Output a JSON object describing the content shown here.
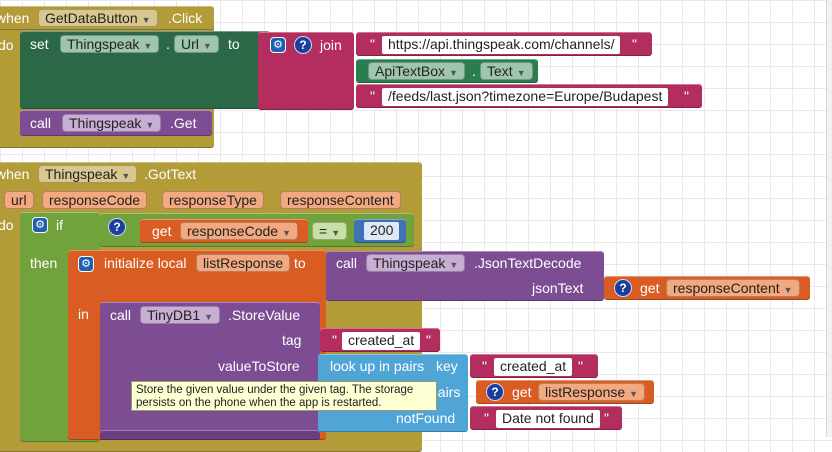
{
  "event1": {
    "when": "when",
    "component": "GetDataButton",
    "event": ".Click",
    "do": "do",
    "set": "set",
    "setComponent": "Thingspeak",
    "setProperty": "Url",
    "to": "to",
    "join": "join",
    "quote": "\"",
    "str1": "https://api.thingspeak.com/channels/",
    "textbox": "ApiTextBox",
    "textProp": "Text",
    "str2": "/feeds/last.json?timezone=Europe/Budapest",
    "call": "call",
    "callComponent": "Thingspeak",
    "callMethod": ".Get"
  },
  "event2": {
    "when": "when",
    "component": "Thingspeak",
    "event": ".GotText",
    "params": [
      "url",
      "responseCode",
      "responseType",
      "responseContent"
    ],
    "do": "do",
    "if": "if",
    "get": "get",
    "getVar": "responseCode",
    "op": "=",
    "num": "200",
    "then": "then",
    "initLocal": "initialize local",
    "localName": "listResponse",
    "to": "to",
    "call": "call",
    "decodeComponent": "Thingspeak",
    "decodeMethod": ".JsonTextDecode",
    "jsonText": "jsonText",
    "getContent": "responseContent",
    "in": "in",
    "storeComponent": "TinyDB1",
    "storeMethod": ".StoreValue",
    "tag": "tag",
    "tagStr": "created_at",
    "valueToStore": "valueToStore",
    "lookup": "look up in pairs",
    "key": "key",
    "keyStr": "created_at",
    "pairs": "pairs",
    "pairsVar": "listResponse",
    "notFound": "notFound",
    "notFoundStr": "Date not found"
  },
  "tooltip": {
    "line1": "Store the given value under the given tag. The storage",
    "line2": "persists on the phone when the app is restarted."
  },
  "colors": {
    "event": "#b39b38",
    "setter": "#2a6848",
    "text": "#b32d5e",
    "control": "#71a23c",
    "variable": "#d95d23",
    "procedure": "#7d4d94",
    "lists": "#4fa5d6",
    "math": "#3f71b5",
    "tooltipBg": "#ffffd4"
  }
}
